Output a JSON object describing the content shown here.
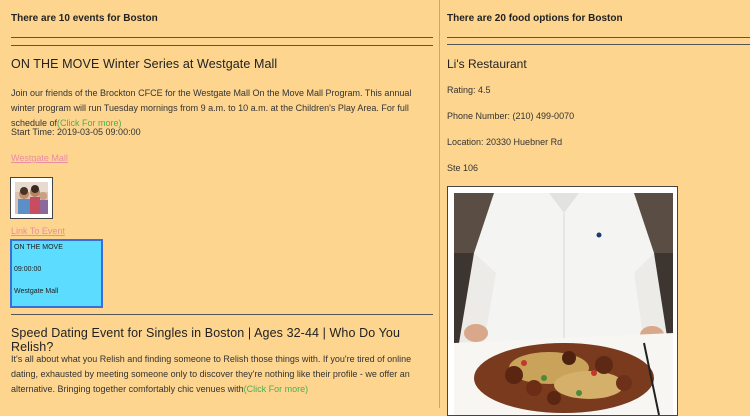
{
  "events": {
    "count_heading": "There are 10 events for Boston",
    "items": [
      {
        "title": "ON THE MOVE Winter Series at Westgate Mall",
        "description": "Join our friends of the Brockton CFCE for the Westgate Mall On the Move Mall Program. This annual winter program will run Tuesday mornings from 9 a.m. to 10 a.m. at the Children's Play Area. For full schedule of",
        "more_link": "(Click For more)",
        "start_time": "Start Time: 2019-03-05 09:00:00",
        "venue_link": "Westgate Mall",
        "event_link": "Link To Event",
        "card": {
          "name": "ON THE MOVE",
          "time": "09:00:00",
          "venue": "Westgate Mall"
        }
      },
      {
        "title": "Speed Dating Event for Singles in Boston | Ages 32-44 | Who Do You Relish?",
        "description": "It's all about what you Relish and finding someone to Relish those things with. If you're tired of online dating, exhausted by meeting someone only to discover they're nothing like their profile - we offer an alternative.  Bringing together comfortably chic venues with",
        "more_link": "(Click For more)"
      }
    ]
  },
  "food": {
    "count_heading": "There are 20 food options for Boston",
    "items": [
      {
        "name": "Li's Restaurant",
        "rating": "Rating: 4.5",
        "phone": "Phone Number: (210) 499-0070",
        "location": "Location: 20330 Huebner Rd",
        "location_line2": "Ste 106"
      }
    ]
  },
  "colors": {
    "background": "#fdd58f",
    "more_link": "#4caf50",
    "venue_link": "#e98ca4",
    "card_fill": "#5cdcff",
    "card_border": "#3b6fd8"
  }
}
